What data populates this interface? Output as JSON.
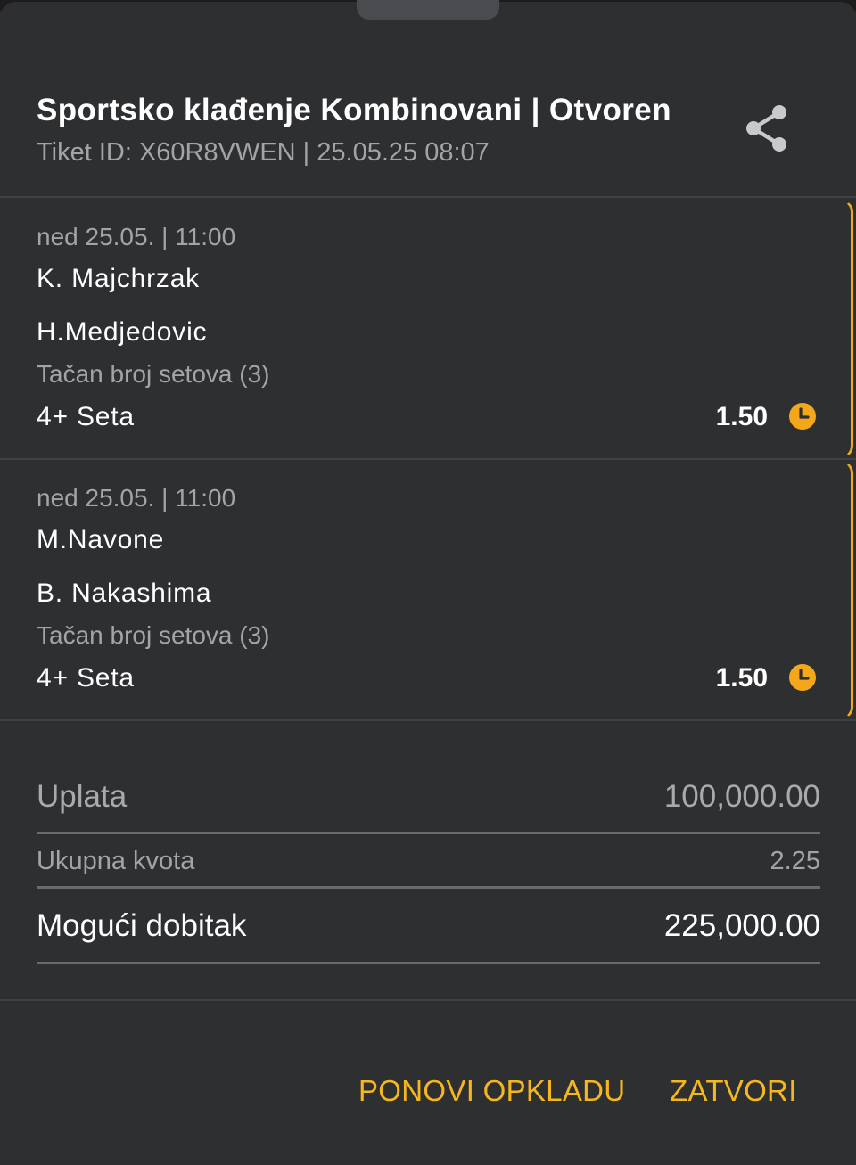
{
  "ticket": {
    "title": "Sportsko klađenje Kombinovani | Otvoren",
    "subtitle": "Tiket ID: X60R8VWEN | 25.05.25 08:07",
    "share_icon": "share-icon"
  },
  "events": [
    {
      "date": "ned 25.05. | 11:00",
      "team1": "K. Majchrzak",
      "team2": "H.Medjedovic",
      "market": "Tačan broj setova (3)",
      "pick": "4+ Seta",
      "odd": "1.50",
      "status_icon": "clock-icon"
    },
    {
      "date": "ned 25.05. | 11:00",
      "team1": "M.Navone",
      "team2": "B. Nakashima",
      "market": "Tačan broj setova (3)",
      "pick": "4+ Seta",
      "odd": "1.50",
      "status_icon": "clock-icon"
    }
  ],
  "summary": {
    "stake_label": "Uplata",
    "stake_value": "100,000.00",
    "total_odds_label": "Ukupna kvota",
    "total_odds_value": "2.25",
    "payout_label": "Mogući dobitak",
    "payout_value": "225,000.00"
  },
  "actions": {
    "repeat_label": "PONOVI OPKLADU",
    "close_label": "ZATVORI"
  },
  "colors": {
    "background": "#2e2f31",
    "accent": "#f5a71b",
    "action_text": "#f5b71e"
  }
}
